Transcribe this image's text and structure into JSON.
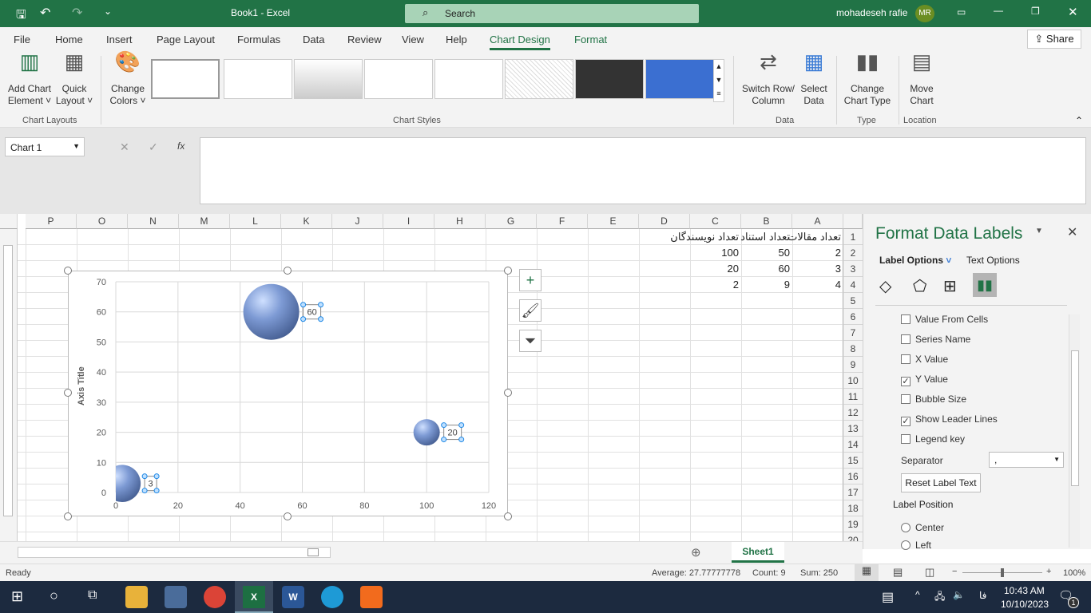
{
  "titlebar": {
    "doc_title": "Book1  -  Excel",
    "search_placeholder": "Search",
    "user": "mohadeseh rafie",
    "initials": "MR"
  },
  "tabs": [
    "File",
    "Home",
    "Insert",
    "Page Layout",
    "Formulas",
    "Data",
    "Review",
    "View",
    "Help",
    "Chart Design",
    "Format"
  ],
  "active_tab": "Chart Design",
  "share": "Share",
  "ribbon": {
    "add_chart_element": [
      "Add Chart",
      "Element ˅"
    ],
    "quick_layout": [
      "Quick",
      "Layout ˅"
    ],
    "change_colors": [
      "Change",
      "Colors ˅"
    ],
    "switch_row_col": [
      "Switch Row/",
      "Column"
    ],
    "select_data": [
      "Select",
      "Data"
    ],
    "change_chart_type": [
      "Change",
      "Chart Type"
    ],
    "move_chart": [
      "Move",
      "Chart"
    ],
    "groups": {
      "chart_layouts": "Chart Layouts",
      "chart_styles": "Chart Styles",
      "data": "Data",
      "type": "Type",
      "location": "Location"
    }
  },
  "formula_bar": {
    "name_box": "Chart 1",
    "fx": "fx",
    "value": ""
  },
  "columns": [
    "A",
    "B",
    "C",
    "D",
    "E",
    "F",
    "G",
    "H",
    "I",
    "J",
    "K",
    "L",
    "M",
    "N",
    "O",
    "P"
  ],
  "rows": [
    1,
    2,
    3,
    4,
    5,
    6,
    7,
    8,
    9,
    10,
    11,
    12,
    13,
    14,
    15,
    16,
    17,
    18,
    19,
    20
  ],
  "cells": {
    "A1": "تعداد مقالات",
    "B1": "تعداد استناد",
    "C1": "تعداد نویسندگان",
    "A2": "2",
    "B2": "50",
    "C2": "100",
    "A3": "3",
    "B3": "60",
    "C3": "20",
    "A4": "4",
    "B4": "9",
    "C4": "2"
  },
  "chart_data": {
    "type": "bubble",
    "x": [
      2,
      100,
      50
    ],
    "y": [
      3,
      20,
      60
    ],
    "size": [
      4,
      2,
      9
    ],
    "data_labels": [
      "3",
      "20",
      "60"
    ],
    "xlim": [
      0,
      120
    ],
    "ylim": [
      0,
      70
    ],
    "xticks": [
      "0",
      "20",
      "40",
      "60",
      "80",
      "100",
      "120"
    ],
    "yticks": [
      "0",
      "10",
      "20",
      "30",
      "40",
      "50",
      "60",
      "70"
    ],
    "ylabel": "Axis Title",
    "grid": true,
    "bubble_color": "#6f8fc9"
  },
  "pane": {
    "title": "Format Data Labels",
    "tab_label_options": "Label Options",
    "tab_text_options": "Text Options",
    "options": [
      {
        "label": "Value From Cells",
        "checked": false
      },
      {
        "label": "Series Name",
        "checked": false
      },
      {
        "label": "X Value",
        "checked": false
      },
      {
        "label": "Y Value",
        "checked": true
      },
      {
        "label": "Bubble Size",
        "checked": false
      },
      {
        "label": "Show Leader Lines",
        "checked": true
      },
      {
        "label": "Legend key",
        "checked": false
      }
    ],
    "separator_label": "Separator",
    "separator_value": ",",
    "reset_button": "Reset Label Text",
    "label_position": "Label Position",
    "positions": [
      {
        "label": "Center",
        "selected": false
      },
      {
        "label": "Left",
        "selected": false
      }
    ]
  },
  "sheet_tab": "Sheet1",
  "status": {
    "ready": "Ready",
    "average": "Average: 27.77777778",
    "count": "Count: 9",
    "sum": "Sum: 250",
    "zoom": "100%"
  },
  "taskbar": {
    "time": "10:43 AM",
    "date": "10/10/2023",
    "lang": "فا",
    "notifications": "1"
  }
}
